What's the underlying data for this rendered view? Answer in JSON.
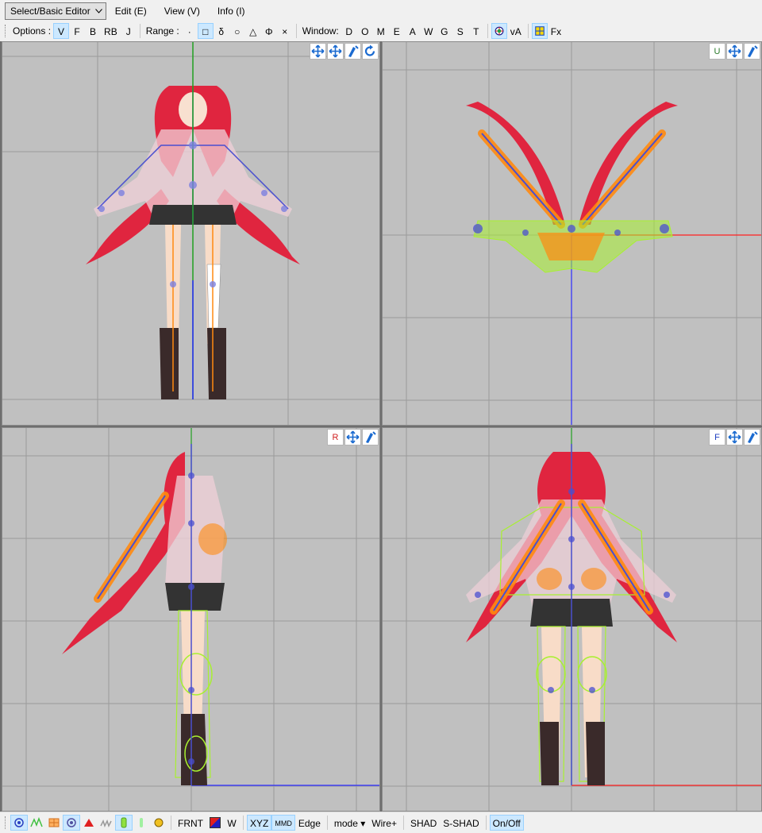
{
  "menubar": {
    "mode_select": "Select/Basic Editor",
    "edit": "Edit (E)",
    "view": "View (V)",
    "info": "Info (I)"
  },
  "options": {
    "label": "Options :",
    "items": [
      "V",
      "F",
      "B",
      "RB",
      "J"
    ],
    "active": "V",
    "range_label": "Range :",
    "range_items": [
      "·",
      "□",
      "δ",
      "○",
      "△",
      "Φ",
      "×"
    ],
    "range_active": "□",
    "window_label": "Window:",
    "window_items": [
      "D",
      "O",
      "M",
      "E",
      "A",
      "W",
      "G",
      "S",
      "T"
    ],
    "va_label": "vA",
    "fx_label": "Fx"
  },
  "viewports": {
    "top_left": {
      "view_letter": ""
    },
    "top_right": {
      "view_letter": "U"
    },
    "bottom_left": {
      "view_letter": "R"
    },
    "bottom_right": {
      "view_letter": "F"
    }
  },
  "bottombar": {
    "frnt": "FRNT",
    "w": "W",
    "xyz": "XYZ",
    "mmd": "MMD",
    "edge": "Edge",
    "mode": "mode",
    "wire": "Wire+",
    "shad": "SHAD",
    "sshad": "S-SHAD",
    "onoff": "On/Off"
  },
  "colors": {
    "viewport_bg": "#c0c0c0",
    "grid": "#9a9a9a",
    "hair_red": "#e0253f",
    "bone_blue": "#4a4fd0",
    "bone_orange": "#ff8a10",
    "rigid_green": "#a8f030",
    "axis_red": "#ff2020",
    "axis_blue": "#2a2aff",
    "axis_green": "#20a020",
    "active_tool": "#cce8ff"
  }
}
